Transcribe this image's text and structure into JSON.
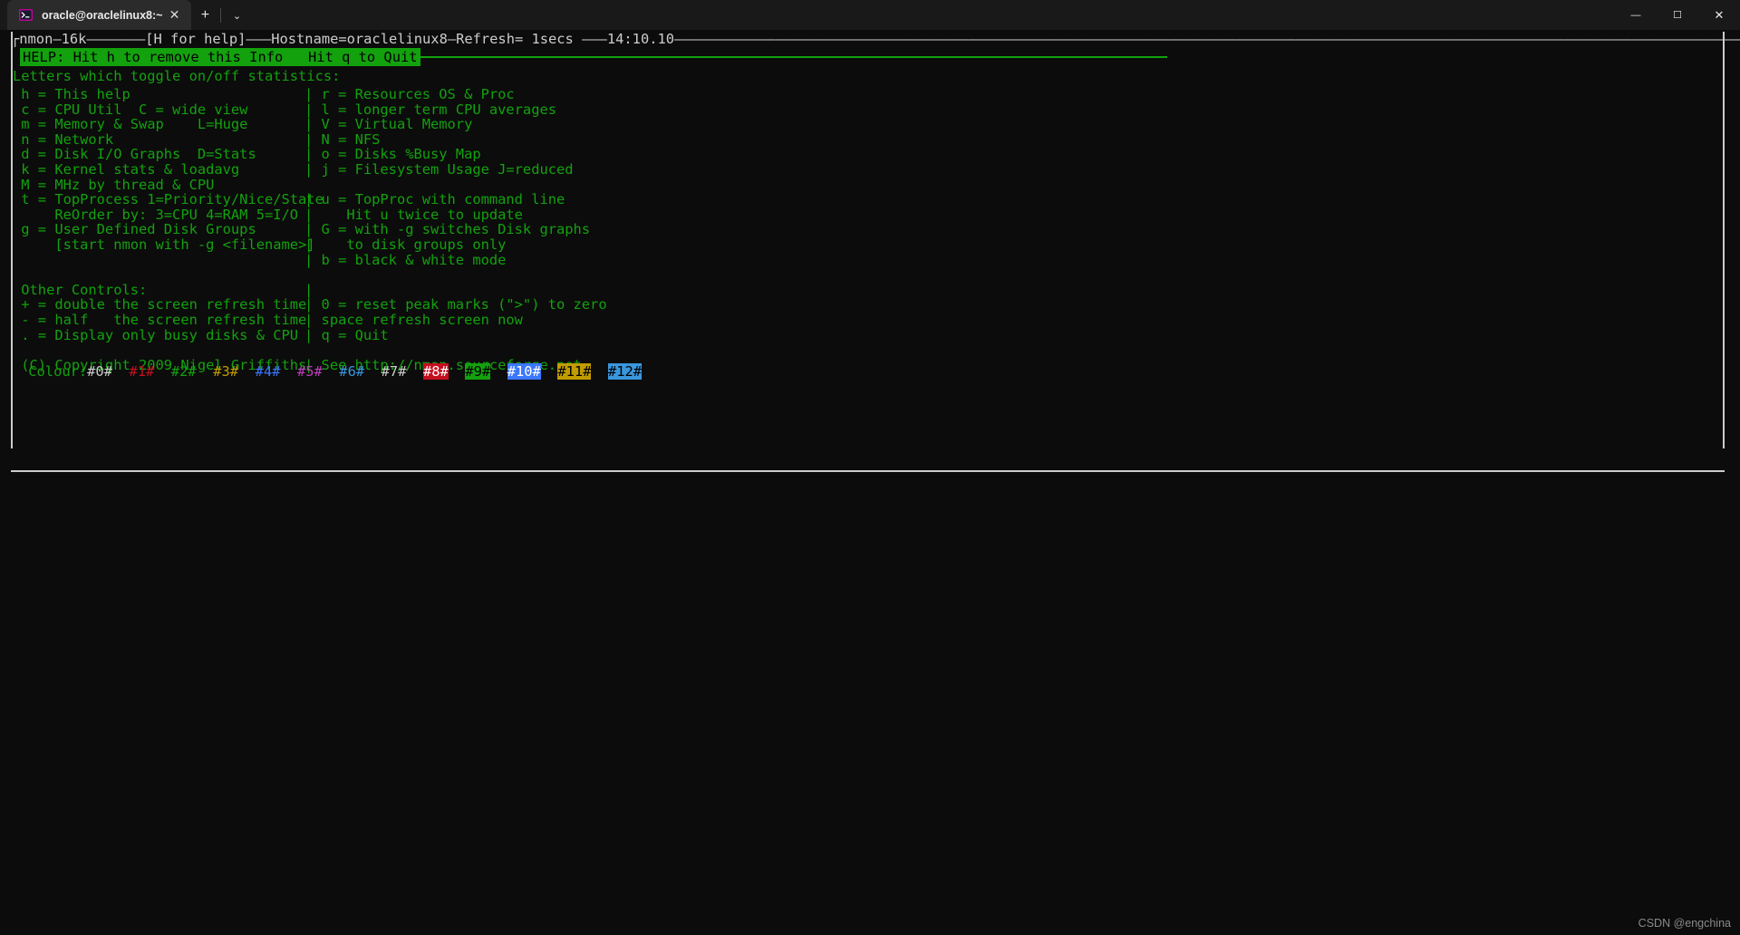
{
  "window": {
    "tab": {
      "title": "oracle@oraclelinux8:~",
      "close_label": "✕",
      "icon_name": "terminal-app-icon"
    },
    "new_tab_label": "+",
    "tab_menu_label": "⌄",
    "controls": {
      "minimize": "—",
      "maximize": "☐",
      "close": "✕"
    }
  },
  "terminal": {
    "nmon_title": "┌nmon—16k———————[H for help]———Hostname=oraclelinux8—Refresh= 1secs ———14:10.10———————————————————————————————————————————————————————————————————————————————————————————————————————————————————————————————",
    "help_banner": "HELP: Hit h to remove this Info   Hit q to Quit",
    "intro": "Letters which toggle on/off statistics:",
    "rows": [
      {
        "left": " h = This help",
        "sep": "|",
        "right": " r = Resources OS & Proc"
      },
      {
        "left": " c = CPU Util  C = wide view",
        "sep": "|",
        "right": " l = longer term CPU averages"
      },
      {
        "left": " m = Memory & Swap    L=Huge",
        "sep": "|",
        "right": " V = Virtual Memory"
      },
      {
        "left": " n = Network",
        "sep": "|",
        "right": " N = NFS"
      },
      {
        "left": " d = Disk I/O Graphs  D=Stats",
        "sep": "|",
        "right": " o = Disks %Busy Map"
      },
      {
        "left": " k = Kernel stats & loadavg",
        "sep": "|",
        "right": " j = Filesystem Usage J=reduced"
      },
      {
        "left": " M = MHz by thread & CPU",
        "sep": "",
        "right": ""
      },
      {
        "left": " t = TopProcess 1=Priority/Nice/State",
        "sep": "|",
        "right": " u = TopProc with command line"
      },
      {
        "left": "     ReOrder by: 3=CPU 4=RAM 5=I/O",
        "sep": "|",
        "right": "    Hit u twice to update"
      },
      {
        "left": " g = User Defined Disk Groups",
        "sep": "|",
        "right": " G = with -g switches Disk graphs"
      },
      {
        "left": "     [start nmon with -g <filename>]",
        "sep": "|",
        "right": "    to disk groups only"
      },
      {
        "left": "",
        "sep": "|",
        "right": " b = black & white mode"
      },
      {
        "left": "",
        "sep": "",
        "right": ""
      },
      {
        "left": " Other Controls:",
        "sep": "|",
        "right": ""
      },
      {
        "left": " + = double the screen refresh time",
        "sep": "|",
        "right": " 0 = reset peak marks (\">\") to zero"
      },
      {
        "left": " - = half   the screen refresh time",
        "sep": "|",
        "right": " space refresh screen now"
      },
      {
        "left": " . = Display only busy disks & CPU",
        "sep": "|",
        "right": " q = Quit"
      },
      {
        "left": "",
        "sep": "",
        "right": ""
      },
      {
        "left": " (C) Copyright 2009 Nigel Griffiths",
        "sep": "|",
        "right": " See http://nmon.sourceforge.net"
      }
    ],
    "colour_label": " Colour:",
    "colour_swatches": [
      {
        "label": "#0#",
        "style": "c-white"
      },
      {
        "label": "#1#",
        "style": "c-red"
      },
      {
        "label": "#2#",
        "style": "c-green"
      },
      {
        "label": "#3#",
        "style": "c-yellow"
      },
      {
        "label": "#4#",
        "style": "c-blue"
      },
      {
        "label": "#5#",
        "style": "c-magenta"
      },
      {
        "label": "#6#",
        "style": "c-cyan"
      },
      {
        "label": "#7#",
        "style": "c-gray"
      },
      {
        "label": "#8#",
        "style": "bg-red"
      },
      {
        "label": "#9#",
        "style": "bg-green"
      },
      {
        "label": "#10#",
        "style": "bg-blue"
      },
      {
        "label": "#11#",
        "style": "bg-yellow"
      },
      {
        "label": "#12#",
        "style": "bg-cyan"
      }
    ],
    "colors": {
      "foreground": "#13a10e",
      "background": "#0c0c0c",
      "border": "#cccccc",
      "banner_bg": "#13a10e",
      "banner_fg": "#000000"
    }
  },
  "watermark": "CSDN @engchina"
}
